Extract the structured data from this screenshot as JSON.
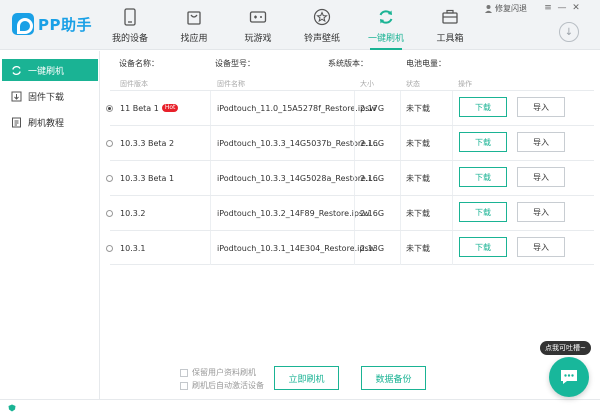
{
  "app": {
    "logo_text": "PP助手"
  },
  "nav": {
    "items": [
      {
        "label": "我的设备",
        "icon": "phone-icon"
      },
      {
        "label": "找应用",
        "icon": "bag-icon"
      },
      {
        "label": "玩游戏",
        "icon": "gamepad-icon"
      },
      {
        "label": "铃声壁纸",
        "icon": "star-icon"
      },
      {
        "label": "一键刷机",
        "icon": "refresh-icon",
        "active": true
      },
      {
        "label": "工具箱",
        "icon": "toolbox-icon"
      }
    ]
  },
  "window": {
    "feedback": "修复闪退"
  },
  "colors": {
    "accent": "#1ab394",
    "logo": "#1aa0e6",
    "hot": "#e8202a"
  },
  "sidebar": {
    "items": [
      {
        "label": "一键刷机",
        "icon": "refresh-icon",
        "active": true
      },
      {
        "label": "固件下载",
        "icon": "download-icon"
      },
      {
        "label": "刷机教程",
        "icon": "document-icon"
      }
    ]
  },
  "device_info": {
    "name_label": "设备名称：",
    "model_label": "设备型号：",
    "version_label": "系统版本：",
    "battery_label": "电池电量："
  },
  "table": {
    "headers": {
      "version": "固件版本",
      "name": "固件名称",
      "size": "大小",
      "status": "状态",
      "action": "操作"
    },
    "rows": [
      {
        "version": "11 Beta 1",
        "hot": "Hot",
        "name": "iPodtouch_11.0_15A5278f_Restore.ipsw",
        "size": "2.17G",
        "status": "未下载",
        "download": "下载",
        "import": "导入",
        "selected": true
      },
      {
        "version": "10.3.3 Beta 2",
        "name": "iPodtouch_10.3.3_14G5037b_Restore.i...",
        "size": "2.16G",
        "status": "未下载",
        "download": "下载",
        "import": "导入"
      },
      {
        "version": "10.3.3 Beta 1",
        "name": "iPodtouch_10.3.3_14G5028a_Restore.i...",
        "size": "2.16G",
        "status": "未下载",
        "download": "下载",
        "import": "导入"
      },
      {
        "version": "10.3.2",
        "name": "iPodtouch_10.3.2_14F89_Restore.ipsw",
        "size": "2.16G",
        "status": "未下载",
        "download": "下载",
        "import": "导入"
      },
      {
        "version": "10.3.1",
        "name": "iPodtouch_10.3.1_14E304_Restore.ipsw",
        "size": "2.13G",
        "status": "未下载",
        "download": "下载",
        "import": "导入"
      }
    ]
  },
  "options": {
    "keep_data": "保留用户资料刷机",
    "auto_activate": "刷机后自动激活设备"
  },
  "buttons": {
    "flash_now": "立即刷机",
    "backup": "数据备份"
  },
  "chat": {
    "tip": "点我可吐槽~"
  }
}
